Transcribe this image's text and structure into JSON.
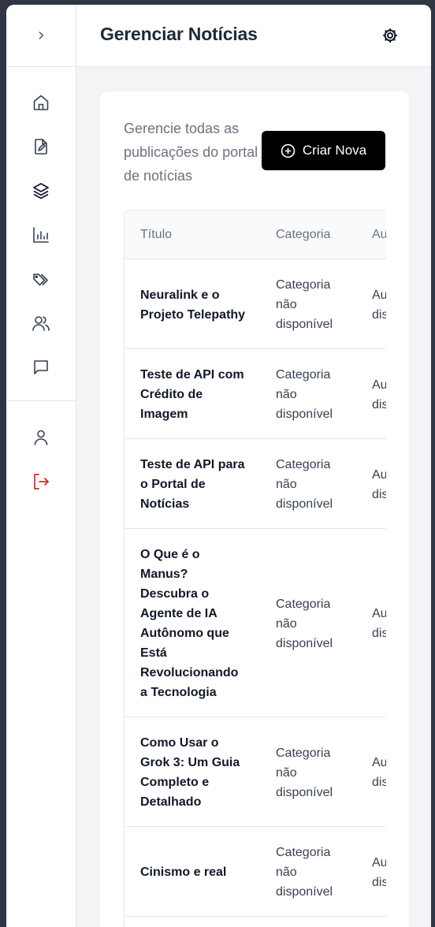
{
  "header": {
    "title": "Gerenciar Notícias"
  },
  "card": {
    "description": "Gerencie todas as publicações do portal de notícias",
    "create_button_label": "Criar Nova"
  },
  "table": {
    "columns": [
      "Título",
      "Categoria",
      "Autor"
    ],
    "rows": [
      {
        "title": "Neuralink e o Projeto Telepathy",
        "category": "Categoria não disponível",
        "author": "Autor não disponível"
      },
      {
        "title": "Teste de API com Crédito de Imagem",
        "category": "Categoria não disponível",
        "author": "Autor não disponível"
      },
      {
        "title": "Teste de API para o Portal de Notícias",
        "category": "Categoria não disponível",
        "author": "Autor não disponível"
      },
      {
        "title": "O Que é o Manus? Descubra o Agente de IA Autônomo que Está Revolucionando a Tecnologia",
        "category": "Categoria não disponível",
        "author": "Autor não disponível"
      },
      {
        "title": "Como Usar o Grok 3: Um Guia Completo e Detalhado",
        "category": "Categoria não disponível",
        "author": "Autor não disponível"
      },
      {
        "title": "Cinismo e real",
        "category": "Categoria não disponível",
        "author": "Autor não disponível"
      }
    ]
  },
  "sidebar": {
    "toggle_icon": "chevron-right-icon",
    "items": [
      "home-icon",
      "edit-file-icon",
      "layers-icon",
      "bar-chart-icon",
      "tags-icon",
      "users-icon",
      "message-square-icon"
    ],
    "bottom": [
      "user-icon",
      "logout-icon"
    ]
  },
  "colors": {
    "primary_button": "#000000",
    "logout": "#dc2626",
    "background": "#f3f4f6"
  }
}
